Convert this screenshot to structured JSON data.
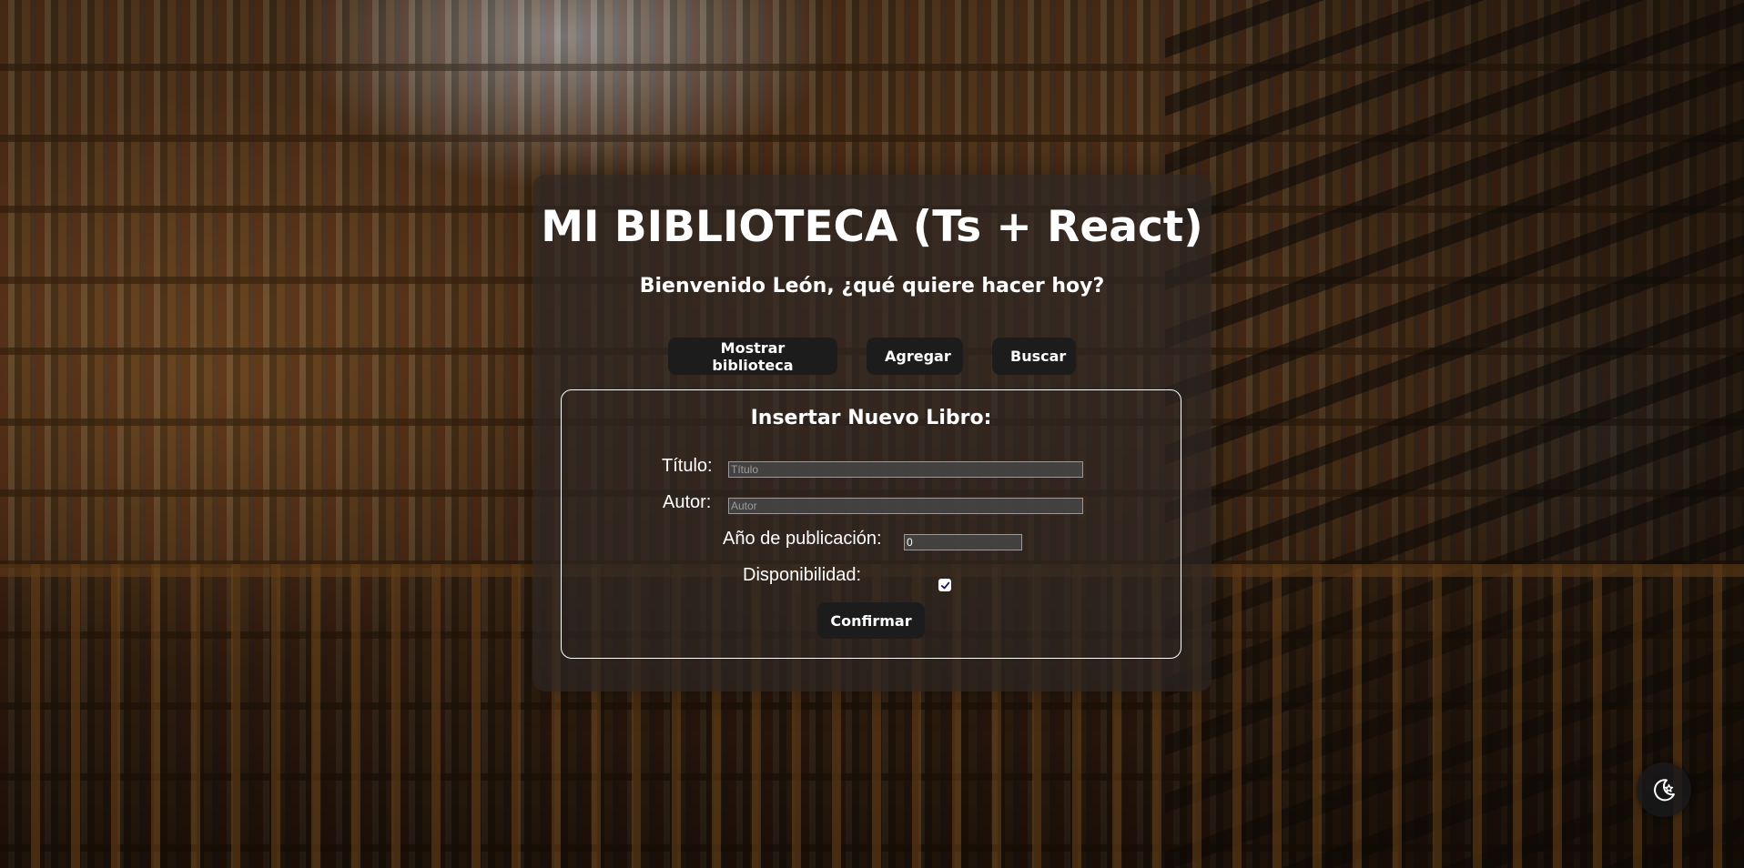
{
  "header": {
    "title": "MI BIBLIOTECA (Ts + React)",
    "subtitle": "Bienvenido León, ¿qué quiere hacer hoy?"
  },
  "nav": {
    "show_label": "Mostrar biblioteca",
    "add_label": "Agregar",
    "search_label": "Buscar"
  },
  "form": {
    "heading": "Insertar Nuevo Libro:",
    "title_label": "Título:",
    "title_placeholder": "Título",
    "title_value": "",
    "author_label": "Autor:",
    "author_placeholder": "Autor",
    "author_value": "",
    "year_label": "Año de publicación:",
    "year_value": "0",
    "availability_label": "Disponibilidad:",
    "availability_checked": true,
    "confirm_label": "Confirmar"
  },
  "theme_toggle": {
    "icon": "moon-star-icon"
  },
  "colors": {
    "button_bg": "#1c1c1c",
    "text": "#ffffff",
    "panel_bg": "rgba(45,38,34,0.72)"
  }
}
